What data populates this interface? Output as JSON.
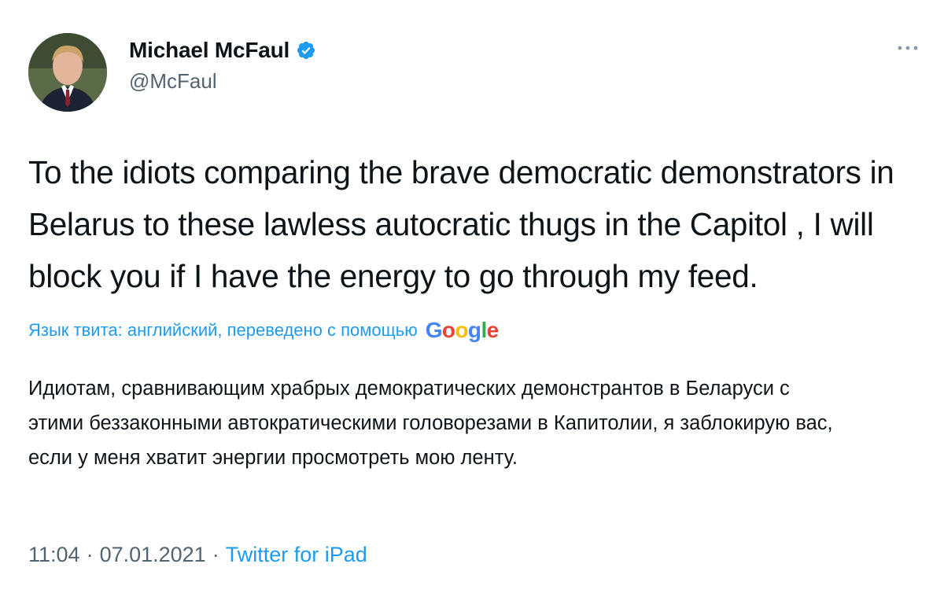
{
  "author": {
    "display_name": "Michael McFaul",
    "handle": "@McFaul",
    "verified": true
  },
  "tweet": {
    "text": "To the idiots comparing the brave democratic demonstrators in Belarus to these lawless autocratic thugs in the Capitol , I will block you if I have the energy to go through my feed."
  },
  "translation": {
    "label": "Язык твита: английский, переведено с помощью",
    "provider": "Google",
    "text": "Идиотам, сравнивающим храбрых демократических демонстрантов в Беларуси с этими беззаконными автократическими головорезами в Капитолии, я заблокирую вас, если у меня хватит энергии просмотреть мою ленту."
  },
  "meta": {
    "time": "11:04",
    "separator": "·",
    "date": "07.01.2021",
    "source": "Twitter for iPad"
  },
  "icons": {
    "verified": "verified-badge-icon",
    "more": "more-options-icon"
  },
  "colors": {
    "link_blue": "#1d9bf0",
    "secondary_gray": "#536471",
    "text": "#0f1419"
  }
}
